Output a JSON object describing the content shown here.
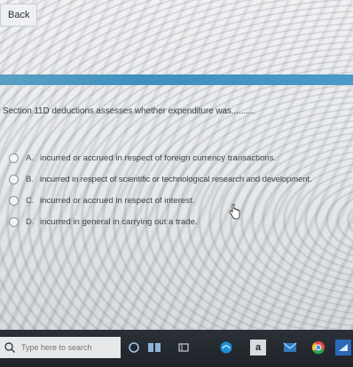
{
  "back_label": "Back",
  "question": "Section 11D deductions assesses whether expenditure was..........",
  "options": [
    {
      "letter": "A.",
      "text": "incurred or accrued in respect of foreign currency transactions."
    },
    {
      "letter": "B.",
      "text": "incurred in respect of scientific or technological research and development."
    },
    {
      "letter": "C.",
      "text": "incurred or accrued in respect of interest."
    },
    {
      "letter": "D.",
      "text": "incurred in general in carrying out a trade."
    }
  ],
  "taskbar": {
    "search_placeholder": "Type here to search",
    "icons": [
      "search-icon",
      "cortana-icon",
      "task-view-icon",
      "edge-icon",
      "store-icon",
      "amazon-icon",
      "mail-icon",
      "chrome-icon",
      "network-icon"
    ]
  },
  "colors": {
    "banner": "#3f8fbf",
    "taskbar": "#1e2328"
  }
}
